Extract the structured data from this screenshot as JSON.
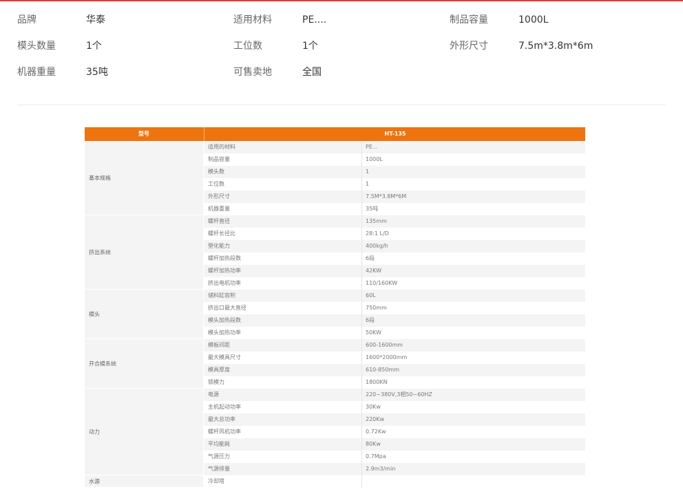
{
  "attributes": [
    {
      "label": "品牌",
      "value": "华泰"
    },
    {
      "label": "适用材料",
      "value": "PE...."
    },
    {
      "label": "制品容量",
      "value": "1000L"
    },
    {
      "label": "模头数量",
      "value": "1个"
    },
    {
      "label": "工位数",
      "value": "1个"
    },
    {
      "label": "外形尺寸",
      "value": "7.5m*3.8m*6m"
    },
    {
      "label": "机器重量",
      "value": "35吨"
    },
    {
      "label": "可售卖地",
      "value": "全国"
    }
  ],
  "spec_table": {
    "header": {
      "col1": "型号",
      "col2": "HT-135"
    },
    "groups": [
      {
        "name": "基本规格",
        "rows": [
          {
            "item": "适用的材料",
            "value": "PE..."
          },
          {
            "item": "制品容量",
            "value": "1000L"
          },
          {
            "item": "模头数",
            "value": "1"
          },
          {
            "item": "工位数",
            "value": "1"
          },
          {
            "item": "外形尺寸",
            "value": "7.5M*3.8M*6M"
          },
          {
            "item": "机器重量",
            "value": "35吨"
          }
        ]
      },
      {
        "name": "挤出系统",
        "rows": [
          {
            "item": "螺杆直径",
            "value": "135mm"
          },
          {
            "item": "螺杆长径比",
            "value": "28:1 L/D"
          },
          {
            "item": "塑化能力",
            "value": "400kg/h"
          },
          {
            "item": "螺杆加热段数",
            "value": "6段"
          },
          {
            "item": "螺杆加热功率",
            "value": "42KW"
          },
          {
            "item": "挤出电机功率",
            "value": "110/160KW"
          }
        ]
      },
      {
        "name": "模头",
        "rows": [
          {
            "item": "储料缸容积",
            "value": "60L"
          },
          {
            "item": "挤出口最大直径",
            "value": "750mm"
          },
          {
            "item": "模头加热段数",
            "value": "6段"
          },
          {
            "item": "模头加热功率",
            "value": "50KW"
          }
        ]
      },
      {
        "name": "开合模系统",
        "rows": [
          {
            "item": "模板间距",
            "value": "600-1600mm"
          },
          {
            "item": "最大模具尺寸",
            "value": "1600*2000mm"
          },
          {
            "item": "模具厚度",
            "value": "610-850mm"
          },
          {
            "item": "锁模力",
            "value": "1800KN"
          }
        ]
      },
      {
        "name": "动力",
        "rows": [
          {
            "item": "电源",
            "value": "220~380V,3相50~60HZ"
          },
          {
            "item": "主机起动功率",
            "value": "30Kw"
          },
          {
            "item": "最大总功率",
            "value": "220Kw"
          },
          {
            "item": "螺杆风机功率",
            "value": "0.72Kw"
          },
          {
            "item": "平均能耗",
            "value": "80Kw"
          },
          {
            "item": "气源压力",
            "value": "0.7Mpa"
          },
          {
            "item": "气源排量",
            "value": "2.9m3/min"
          }
        ]
      },
      {
        "name": "水源",
        "rows": [
          {
            "item": "冷却塔",
            "value": ""
          }
        ]
      }
    ]
  }
}
